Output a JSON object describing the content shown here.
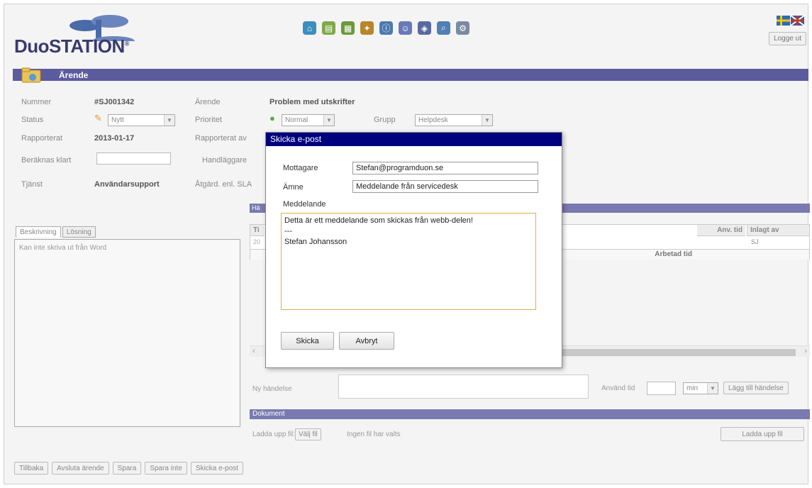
{
  "app": {
    "logo_text": "DuoSTATION",
    "logo_reg": "®",
    "logout": "Logge ut"
  },
  "toolbar_icons": [
    "home-icon",
    "folder-icon",
    "report-icon",
    "tools-icon",
    "info-icon",
    "people-icon",
    "ticket-icon",
    "search-icon",
    "settings-icon"
  ],
  "section": {
    "title": "Ärende"
  },
  "fields": {
    "nummer_label": "Nummer",
    "nummer_value": "#SJ001342",
    "status_label": "Status",
    "status_value": "Nytt",
    "rapporterat_label": "Rapporterat",
    "rapporterat_value": "2013-01-17",
    "beraknas_label": "Beräknas klart",
    "tjanst_label": "Tjänst",
    "tjanst_value": "Användarsupport",
    "arende_label": "Ärende",
    "arende_value": "Problem med utskrifter",
    "prioritet_label": "Prioritet",
    "prioritet_value": "Normal",
    "grupp_label": "Grupp",
    "grupp_value": "Helpdesk",
    "rapporterat_av_label": "Rapporterat av",
    "handlaggare_label": "Handläggare",
    "atgard_label": "Åtgärd. enl. SLA"
  },
  "left_panel": {
    "tabs": [
      "Beskrivning",
      "Lösning"
    ],
    "description": "Kan inte skriva ut från Word"
  },
  "right_panel": {
    "bar_label": "Hä",
    "col_ti": "Ti",
    "row_prefix": "20",
    "col_anv_tid": "Anv. tid",
    "col_inlagt_av": "Inlagt av",
    "row_inlagt": "SJ",
    "arbetad_tid": "Arbetad tid",
    "ny_handelse_label": "Ny händelse",
    "anvand_tid_label": "Använd tid",
    "unit_value": "min",
    "add_event_button": "Lägg till händelse",
    "dokument_label": "Dokument",
    "upload_label": "Ladda upp fil:",
    "choose_file_button": "Välj fil",
    "no_file_text": "Ingen fil har valts",
    "upload_button": "Ladda upp fil"
  },
  "bottom_buttons": [
    "Tillbaka",
    "Avsluta ärende",
    "Spara",
    "Spara inte",
    "Skicka e-post"
  ],
  "dialog": {
    "title": "Skicka e-post",
    "recipient_label": "Mottagare",
    "recipient_value": "Stefan@programduon.se",
    "subject_label": "Ämne",
    "subject_value": "Meddelande från servicedesk",
    "message_label": "Meddelande",
    "message_value": "Detta är ett meddelande som skickas från webb-delen!\n---\nStefan Johansson",
    "send_button": "Skicka",
    "cancel_button": "Avbryt"
  }
}
